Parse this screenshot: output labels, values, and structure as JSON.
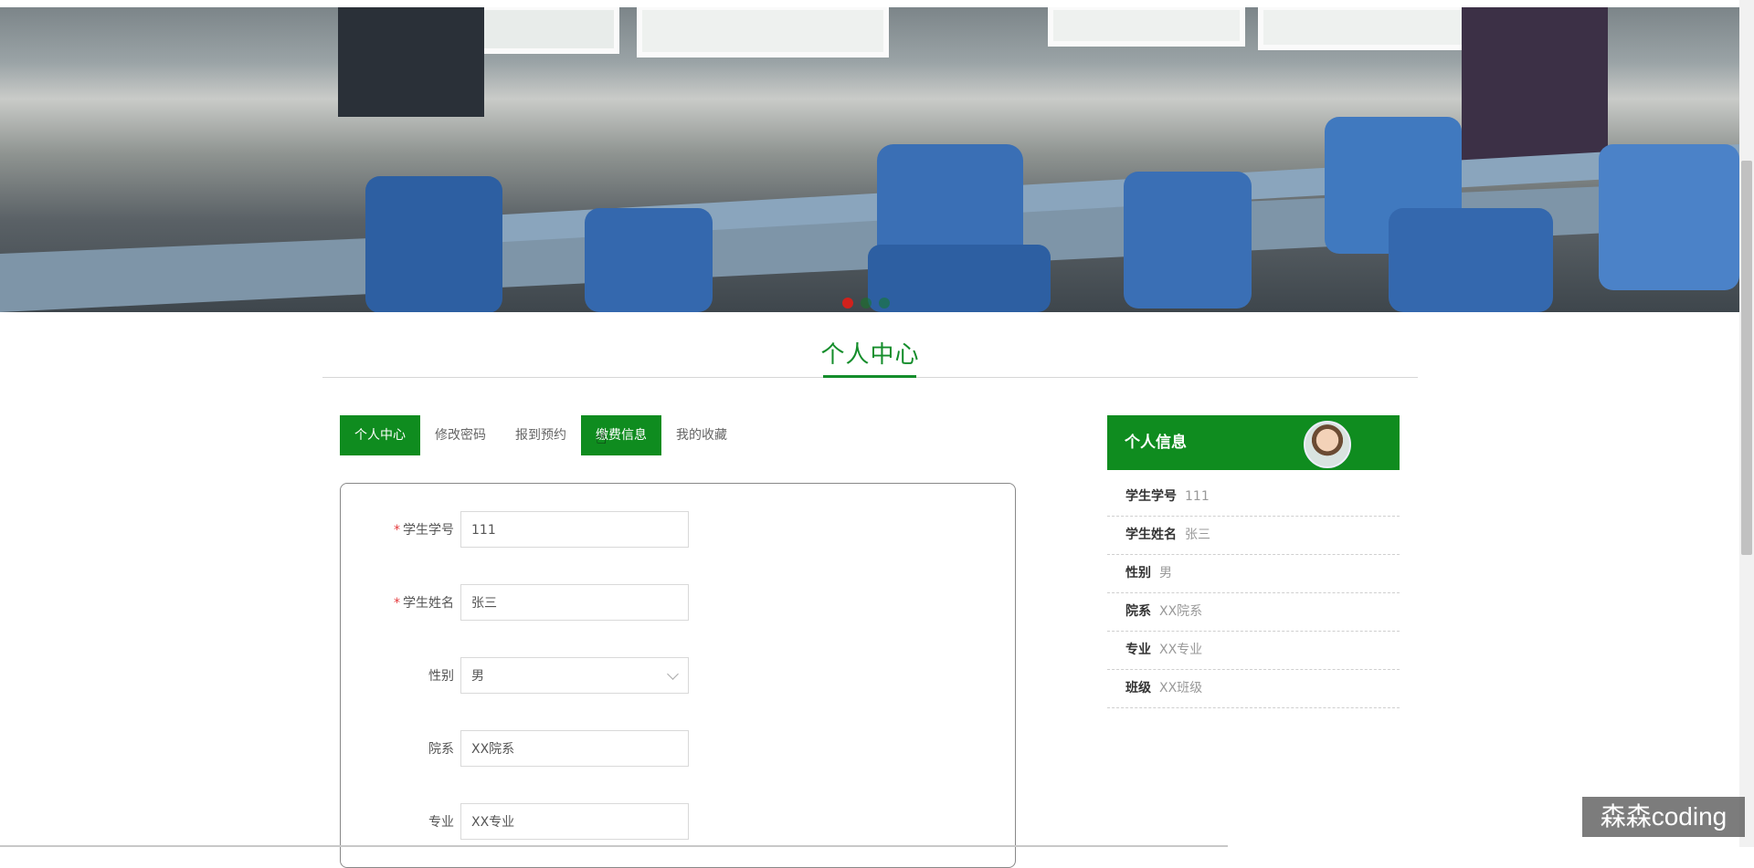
{
  "banner": {
    "slide_count": 3,
    "active_slide": 1
  },
  "section_title": "个人中心",
  "tabs": [
    {
      "label": "个人中心",
      "active": true
    },
    {
      "label": "修改密码",
      "active": false
    },
    {
      "label": "报到预约",
      "active": false
    },
    {
      "label": "缴费信息",
      "active": true
    },
    {
      "label": "我的收藏",
      "active": false
    }
  ],
  "form": {
    "fields": [
      {
        "label": "学生学号",
        "required": true,
        "value": "111"
      },
      {
        "label": "学生姓名",
        "required": true,
        "value": "张三"
      },
      {
        "label": "性别",
        "required": false,
        "value": "男",
        "type": "select"
      },
      {
        "label": "院系",
        "required": false,
        "value": "XX院系"
      },
      {
        "label": "专业",
        "required": false,
        "value": "XX专业"
      }
    ]
  },
  "info_panel": {
    "title": "个人信息",
    "rows": [
      {
        "label": "学生学号",
        "value": "111"
      },
      {
        "label": "学生姓名",
        "value": "张三"
      },
      {
        "label": "性别",
        "value": "男"
      },
      {
        "label": "院系",
        "value": "XX院系"
      },
      {
        "label": "专业",
        "value": "XX专业"
      },
      {
        "label": "班级",
        "value": "XX班级"
      }
    ]
  },
  "watermark": "森森coding",
  "colors": {
    "primary": "#0f8c1f",
    "accent_red": "#d0211c"
  }
}
